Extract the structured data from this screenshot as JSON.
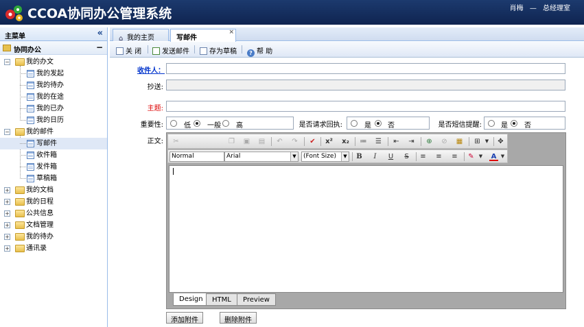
{
  "app": {
    "title": "CCOA协同办公管理系统",
    "user_name": "肖梅",
    "user_sep": "—",
    "user_role": "总经理室"
  },
  "sidebar": {
    "title": "主菜单",
    "collapse_icon": "double-chevron-left-icon",
    "group": "协同办公",
    "tree": [
      {
        "label": "我的办文",
        "expanded": true,
        "children": [
          "我的发起",
          "我的待办",
          "我的在途",
          "我的已办",
          "我的日历"
        ]
      },
      {
        "label": "我的邮件",
        "expanded": true,
        "children": [
          "写邮件",
          "收件箱",
          "发件箱",
          "草稿箱"
        ],
        "selected_child": "写邮件"
      },
      {
        "label": "我的文档",
        "expanded": false
      },
      {
        "label": "我的日程",
        "expanded": false
      },
      {
        "label": "公共信息",
        "expanded": false
      },
      {
        "label": "文档管理",
        "expanded": false
      },
      {
        "label": "我的待办",
        "expanded": false
      },
      {
        "label": "通讯录",
        "expanded": false
      }
    ]
  },
  "tabs": [
    {
      "label": "我的主页",
      "icon": "home-icon",
      "active": false
    },
    {
      "label": "写邮件",
      "active": true,
      "close": "×"
    }
  ],
  "toolbar": {
    "close": "关 闭",
    "send": "发送邮件",
    "save_draft": "存为草稿",
    "help": "帮 助"
  },
  "form": {
    "recipient_label": "收件人：",
    "cc_label": "抄送:",
    "subject_label": "主题:",
    "importance_label": "重要性:",
    "importance_options": [
      "低",
      "一般",
      "高"
    ],
    "importance_selected": "一般",
    "receipt_label": "是否请求回执:",
    "receipt_options": [
      "是",
      "否"
    ],
    "receipt_selected": "否",
    "sms_label": "是否短信提醒:",
    "sms_options": [
      "是",
      "否"
    ],
    "sms_selected": "否",
    "body_label": "正文:"
  },
  "editor": {
    "format_value": "Normal",
    "font_value": "Arial",
    "size_value": "(Font Size)",
    "modes": [
      "Design",
      "HTML",
      "Preview"
    ],
    "active_mode": "Design"
  },
  "buttons": {
    "add_attachment": "添加附件",
    "remove_attachment": "删除附件"
  }
}
